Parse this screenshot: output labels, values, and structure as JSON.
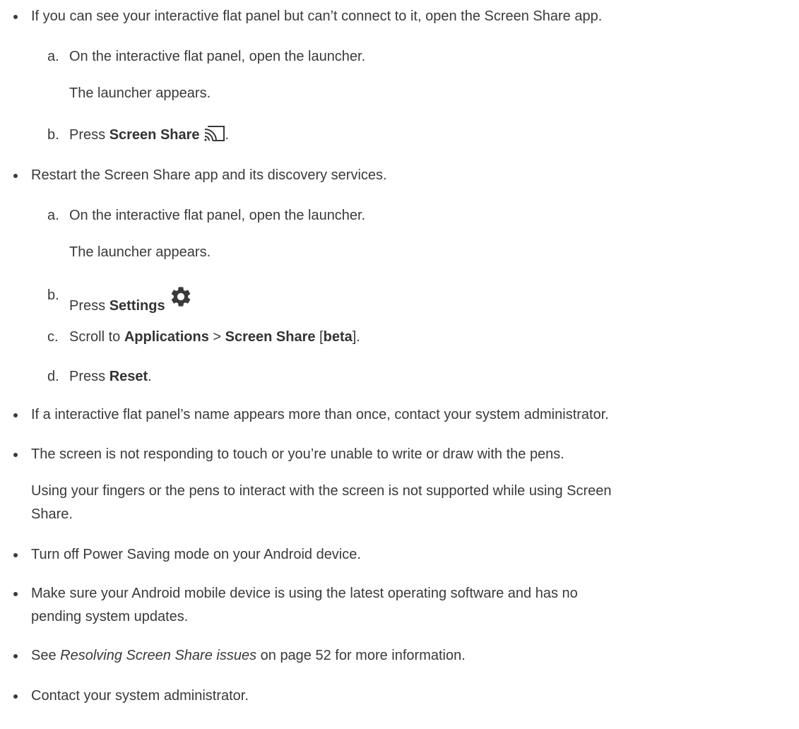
{
  "items": [
    {
      "text": "If you can see your interactive flat panel but can’t connect to it, open the Screen Share app.",
      "steps": [
        {
          "letter": "a.",
          "text": "On the interactive flat panel, open the launcher.",
          "note": "The launcher appears."
        },
        {
          "letter": "b.",
          "prefix": "Press ",
          "bold": "Screen Share",
          "suffix": ".",
          "icon": "cast-icon"
        }
      ]
    },
    {
      "text": "Restart the Screen Share app and its discovery services.",
      "steps": [
        {
          "letter": "a.",
          "text": "On the interactive flat panel, open the launcher.",
          "note": "The launcher appears."
        },
        {
          "letter": "b.",
          "prefix": "Press ",
          "bold": "Settings",
          "icon": "gear-icon"
        },
        {
          "letter": "c.",
          "prefix": "Scroll to ",
          "bold1": "Applications",
          "mid1": " > ",
          "bold2": "Screen Share",
          "mid2": " [",
          "bold3": "beta",
          "suffix": "]."
        },
        {
          "letter": "d.",
          "prefix": "Press ",
          "bold": "Reset",
          "suffix": "."
        }
      ]
    },
    {
      "text": "If a interactive flat panel’s name appears more than once, contact your system administrator."
    },
    {
      "text": "The screen is not responding to touch or you’re unable to write or draw with the pens.",
      "note_line1": "Using your fingers or the pens to interact with the screen is not supported while using Screen",
      "note_line2": "Share."
    },
    {
      "text": "Turn off Power Saving mode on your Android device."
    },
    {
      "text_line1": "Make sure your Android mobile device is using the latest operating software and has no",
      "text_line2": "pending system updates."
    },
    {
      "prefix": "See ",
      "italic": "Resolving Screen Share issues",
      "suffix": " on page 52 for more information."
    },
    {
      "text": "Contact your system administrator."
    }
  ]
}
